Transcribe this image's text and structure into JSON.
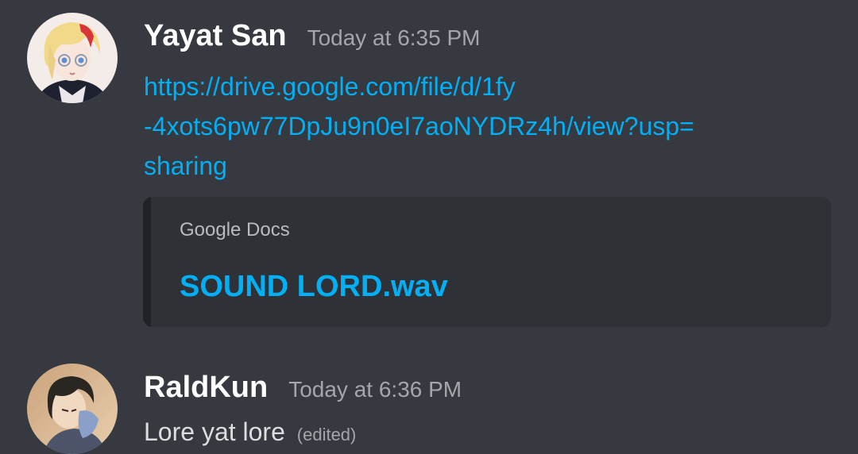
{
  "messages": [
    {
      "author": "Yayat San",
      "timestamp": "Today at 6:35 PM",
      "avatar_icon": "anime-character-avatar-blonde-red-streak",
      "link_lines": [
        "https://drive.google.com/file/d/1fy",
        "-4xots6pw77DpJu9n0eI7aoNYDRz4h/view?usp=",
        "sharing"
      ],
      "embed": {
        "provider": "Google Docs",
        "title": "SOUND LORD.wav"
      }
    },
    {
      "author": "RaldKun",
      "timestamp": "Today at 6:36 PM",
      "avatar_icon": "anime-character-avatar-dark-hair",
      "text": "Lore yat lore",
      "edited_label": "(edited)"
    }
  ],
  "colors": {
    "background": "#36393f",
    "embed_background": "#2f3136",
    "link": "#00aff4",
    "username": "#ffffff",
    "timestamp": "#a3a6aa",
    "text": "#dcddde"
  }
}
